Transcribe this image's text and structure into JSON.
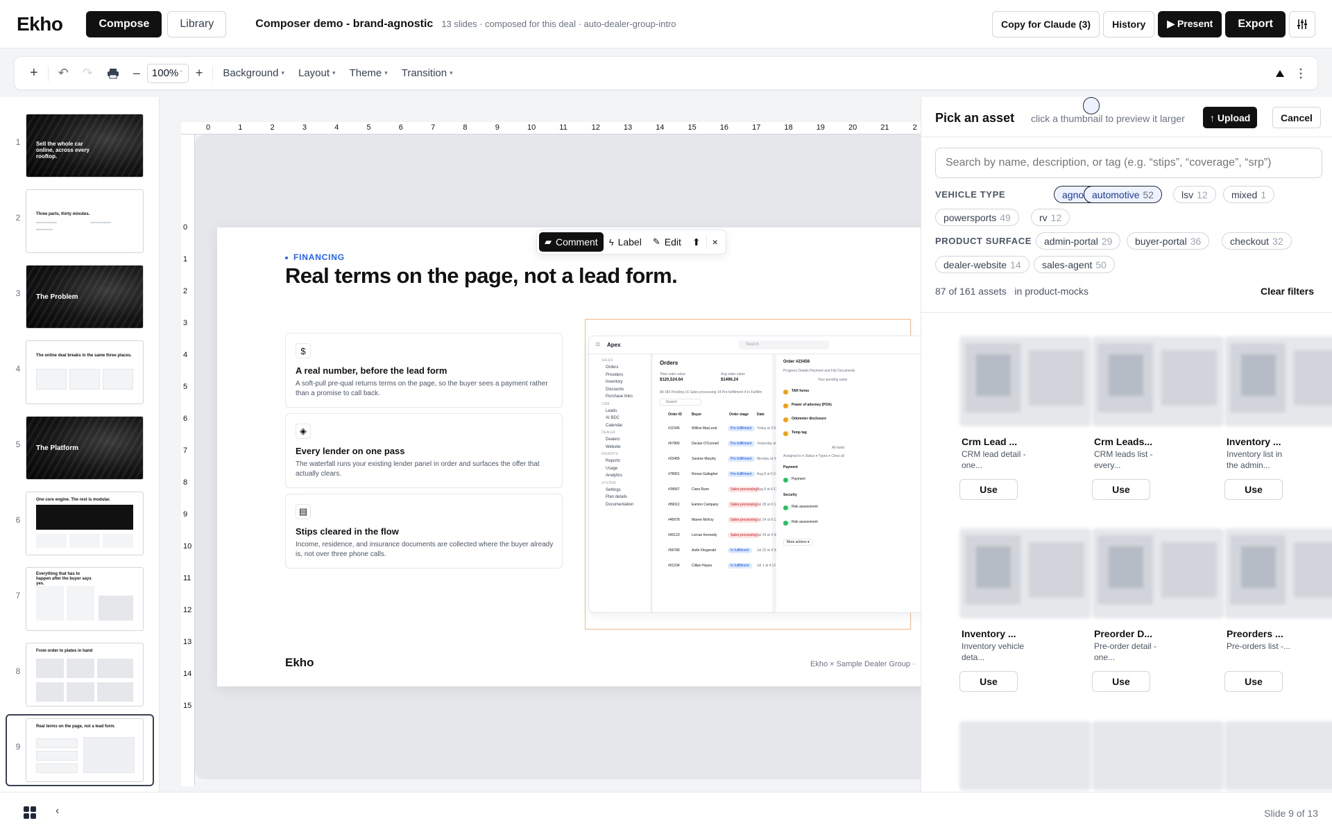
{
  "header": {
    "logo": "Ekho",
    "compose_label": "Compose",
    "library_label": "Library",
    "doc_title": "Composer demo - brand-agnostic",
    "doc_meta": "13 slides · composed for this deal · auto-dealer-group-intro",
    "copy_label": "Copy for Claude (3)",
    "history_label": "History",
    "present_label": "▶ Present",
    "export_label": "Export"
  },
  "toolbar": {
    "add": "+",
    "undo": "↶",
    "redo": "↷",
    "minus": "–",
    "zoom": "100%",
    "zoom_caret": "⌃",
    "plus": "+",
    "background": "Background",
    "layout": "Layout",
    "theme": "Theme",
    "transition": "Transition",
    "caret": "▾"
  },
  "rail": {
    "slides": [
      {
        "num": "1",
        "title": "Sell the whole car online, across every rooftop."
      },
      {
        "num": "2",
        "title": "Three parts, thirty minutes."
      },
      {
        "num": "3",
        "title": "The Problem"
      },
      {
        "num": "4",
        "title": "The online deal breaks in the same three places."
      },
      {
        "num": "5",
        "title": "The Platform"
      },
      {
        "num": "6",
        "title": "One core engine. The rest is modular."
      },
      {
        "num": "7",
        "title": "Everything that has to happen after the buyer says yes."
      },
      {
        "num": "8",
        "title": "From order to plates in hand"
      },
      {
        "num": "9",
        "title": "Real terms on the page, not a lead form."
      }
    ]
  },
  "ruler": {
    "h": [
      "0",
      "1",
      "2",
      "3",
      "4",
      "5",
      "6",
      "7",
      "8",
      "9",
      "10",
      "11",
      "12",
      "13",
      "14",
      "15",
      "16",
      "17",
      "18",
      "19",
      "20",
      "21",
      "2"
    ],
    "v": [
      "0",
      "1",
      "2",
      "3",
      "4",
      "5",
      "6",
      "7",
      "8",
      "9",
      "10",
      "11",
      "12",
      "13",
      "14",
      "15"
    ]
  },
  "slide": {
    "kicker": "FINANCING",
    "title": "Real terms on the page, not a lead form.",
    "cards": [
      {
        "icon": "$",
        "title": "A real number, before the lead form",
        "body": "A soft-pull pre-qual returns terms on the page, so the buyer sees a payment rather than a promise to call back."
      },
      {
        "icon": "◈",
        "title": "Every lender on one pass",
        "body": "The waterfall runs your existing lender panel in order and surfaces the offer that actually clears."
      },
      {
        "icon": "▤",
        "title": "Stips cleared in the flow",
        "body": "Income, residence, and insurance documents are collected where the buyer already is, not over three phone calls."
      }
    ],
    "logo": "Ekho",
    "footer": "Ekho × Sample Dealer Group ·"
  },
  "mock": {
    "brand": "Apex",
    "search": "Search",
    "nav": [
      "Orders",
      "Providers",
      "Inventory",
      "Discounts",
      "Purchase links",
      "Leads",
      "AI BDC",
      "Calendar",
      "Dealers",
      "Website",
      "Reports",
      "Usage",
      "Analytics",
      "Settings",
      "Plan details",
      "Documentation"
    ],
    "nav_heads": [
      "SALES",
      "CRM",
      "DEALER",
      "INSIGHTS",
      "SYSTEM"
    ],
    "orders_title": "Orders",
    "total_label": "Total order value",
    "total_value": "$120,524.64",
    "avg_label": "Avg order value",
    "avg_value": "$1496.24",
    "filter_tabs": "All 180   Pending 16   Sales processing 14   Pre-fulfillment 4   In Fulfillm",
    "search2": "Search",
    "col_headers": [
      "Order ID",
      "Buyer",
      "Order stage",
      "Date"
    ],
    "rows": [
      {
        "id": "#12345",
        "buyer": "Willow MacLeod",
        "stage": "Pre-fulfillment",
        "date": "Today at 3:52 PM"
      },
      {
        "id": "#67890",
        "buyer": "Declan O'Connell",
        "stage": "Pre-fulfillment",
        "date": "Yesterday at 4"
      },
      {
        "id": "#23456",
        "buyer": "Saoirse Murphy",
        "stage": "Pre-fulfillment",
        "date": "Monday at 9:41"
      },
      {
        "id": "#78901",
        "buyer": "Ronan Gallagher",
        "stage": "Pre-fulfillment",
        "date": "Aug 8 at 6:24 AM"
      },
      {
        "id": "#34567",
        "buyer": "Ciara Ryne",
        "stage": "Sales processing",
        "date": "Aug 8 at 6:13 PM"
      },
      {
        "id": "#89012",
        "buyer": "Eamon Campany",
        "stage": "Sales processing",
        "date": "Jul 28 at 6:12 PM"
      },
      {
        "id": "#45678",
        "buyer": "Maeve McKoy",
        "stage": "Sales processing",
        "date": "Jul 24 at 6:12 PM"
      },
      {
        "id": "#90123",
        "buyer": "Lorcan Kennedy",
        "stage": "Sales processing",
        "date": "Jul 24 at 4:36 PM"
      },
      {
        "id": "#56789",
        "buyer": "Aoife Fitzgerald",
        "stage": "In fulfillment",
        "date": "Jul 23 at 4:36 PM"
      },
      {
        "id": "#01234",
        "buyer": "Cillian Hayes",
        "stage": "In fulfillment",
        "date": "Jul 1 at 4:12 AM"
      }
    ],
    "detail_title": "Order #23456",
    "detail_tabs": "Progress   Details   Payment and F&I   Documents",
    "pending": "Your pending tasks",
    "tasks": [
      "TAR forms",
      "Power of attorney (POA)",
      "Odometer disclosure",
      "Temp tag"
    ],
    "all_tasks": "All tasks",
    "assigned": "Assigned to ▾   Status ▾   Types ▾   Clear all",
    "payment": "Payment",
    "payment_item": "Payment",
    "security": "Security",
    "risk1": "Risk assessment",
    "risk2": "Risk assessment",
    "more": "More actions ▾"
  },
  "floating": {
    "comment": "Comment",
    "label": "Label",
    "edit": "Edit",
    "close": "×"
  },
  "panel": {
    "title": "Pick an asset",
    "hint": "click a thumbnail to preview it larger",
    "upload": "↑ Upload",
    "cancel": "Cancel",
    "search_placeholder": "Search by name, description, or tag (e.g. “stips”, “coverage”, “srp”)",
    "vehicle_label": "VEHICLE TYPE",
    "vehicle_chips": [
      {
        "name": "agnostic",
        "count": "35",
        "selected": true
      },
      {
        "name": "automotive",
        "count": "52",
        "selected": true
      },
      {
        "name": "lsv",
        "count": "12",
        "selected": false
      },
      {
        "name": "mixed",
        "count": "1",
        "selected": false
      },
      {
        "name": "powersports",
        "count": "49",
        "selected": false
      },
      {
        "name": "rv",
        "count": "12",
        "selected": false
      }
    ],
    "surface_label": "PRODUCT SURFACE",
    "surface_chips": [
      {
        "name": "admin-portal",
        "count": "29"
      },
      {
        "name": "buyer-portal",
        "count": "36"
      },
      {
        "name": "checkout",
        "count": "32"
      },
      {
        "name": "dealer-website",
        "count": "14"
      },
      {
        "name": "sales-agent",
        "count": "50"
      }
    ],
    "count_text": "87 of 161 assets",
    "scope_text": "in product-mocks",
    "clear": "Clear filters",
    "use_label": "Use",
    "assets": [
      {
        "title": "Crm Lead ...",
        "desc": "CRM lead detail - one..."
      },
      {
        "title": "Crm Leads...",
        "desc": "CRM leads list - every..."
      },
      {
        "title": "Inventory ...",
        "desc": "Inventory list in the admin..."
      },
      {
        "title": "Inventory ...",
        "desc": "Inventory vehicle deta..."
      },
      {
        "title": "Preorder D...",
        "desc": "Pre-order detail - one..."
      },
      {
        "title": "Preorders ...",
        "desc": "Pre-orders list -..."
      }
    ]
  },
  "bottom": {
    "collapse": "‹",
    "indicator": "Slide 9 of 13"
  }
}
